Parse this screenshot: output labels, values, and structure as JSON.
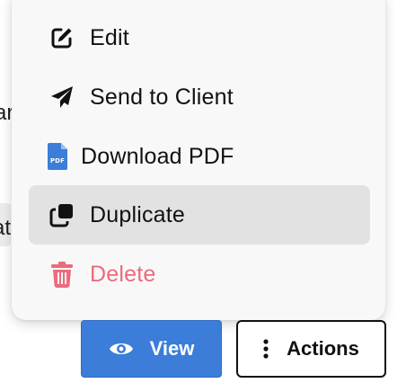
{
  "background": {
    "fragment_1": "ar",
    "fragment_2": "at"
  },
  "menu": {
    "items": [
      {
        "label": "Edit",
        "icon": "edit-icon"
      },
      {
        "label": "Send to Client",
        "icon": "paper-plane-icon"
      },
      {
        "label": "Download PDF",
        "icon": "pdf-file-icon"
      },
      {
        "label": "Duplicate",
        "icon": "duplicate-icon",
        "active": true
      },
      {
        "label": "Delete",
        "icon": "trash-icon",
        "danger": true
      }
    ]
  },
  "buttons": {
    "view_label": "View",
    "actions_label": "Actions"
  },
  "colors": {
    "primary": "#3b7dd8",
    "danger": "#ec6a7d",
    "pdf_icon": "#3b7dd8",
    "menu_bg": "#f8f8f8",
    "active_bg": "#e2e2e2"
  }
}
